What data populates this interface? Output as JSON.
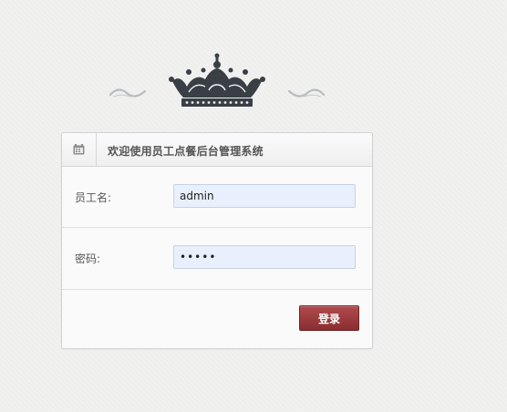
{
  "panel": {
    "title": "欢迎使用员工点餐后台管理系统",
    "icon": "calendar-box-icon"
  },
  "form": {
    "username_label": "员工名:",
    "username_value": "admin",
    "password_label": "密码:",
    "password_value": "•••••"
  },
  "actions": {
    "login_label": "登录"
  },
  "decor": {
    "crown_icon": "crown-icon",
    "swirl_icon": "swirl-ornament-icon",
    "crown_color": "#3a3f46",
    "button_color": "#9c3a3d"
  }
}
